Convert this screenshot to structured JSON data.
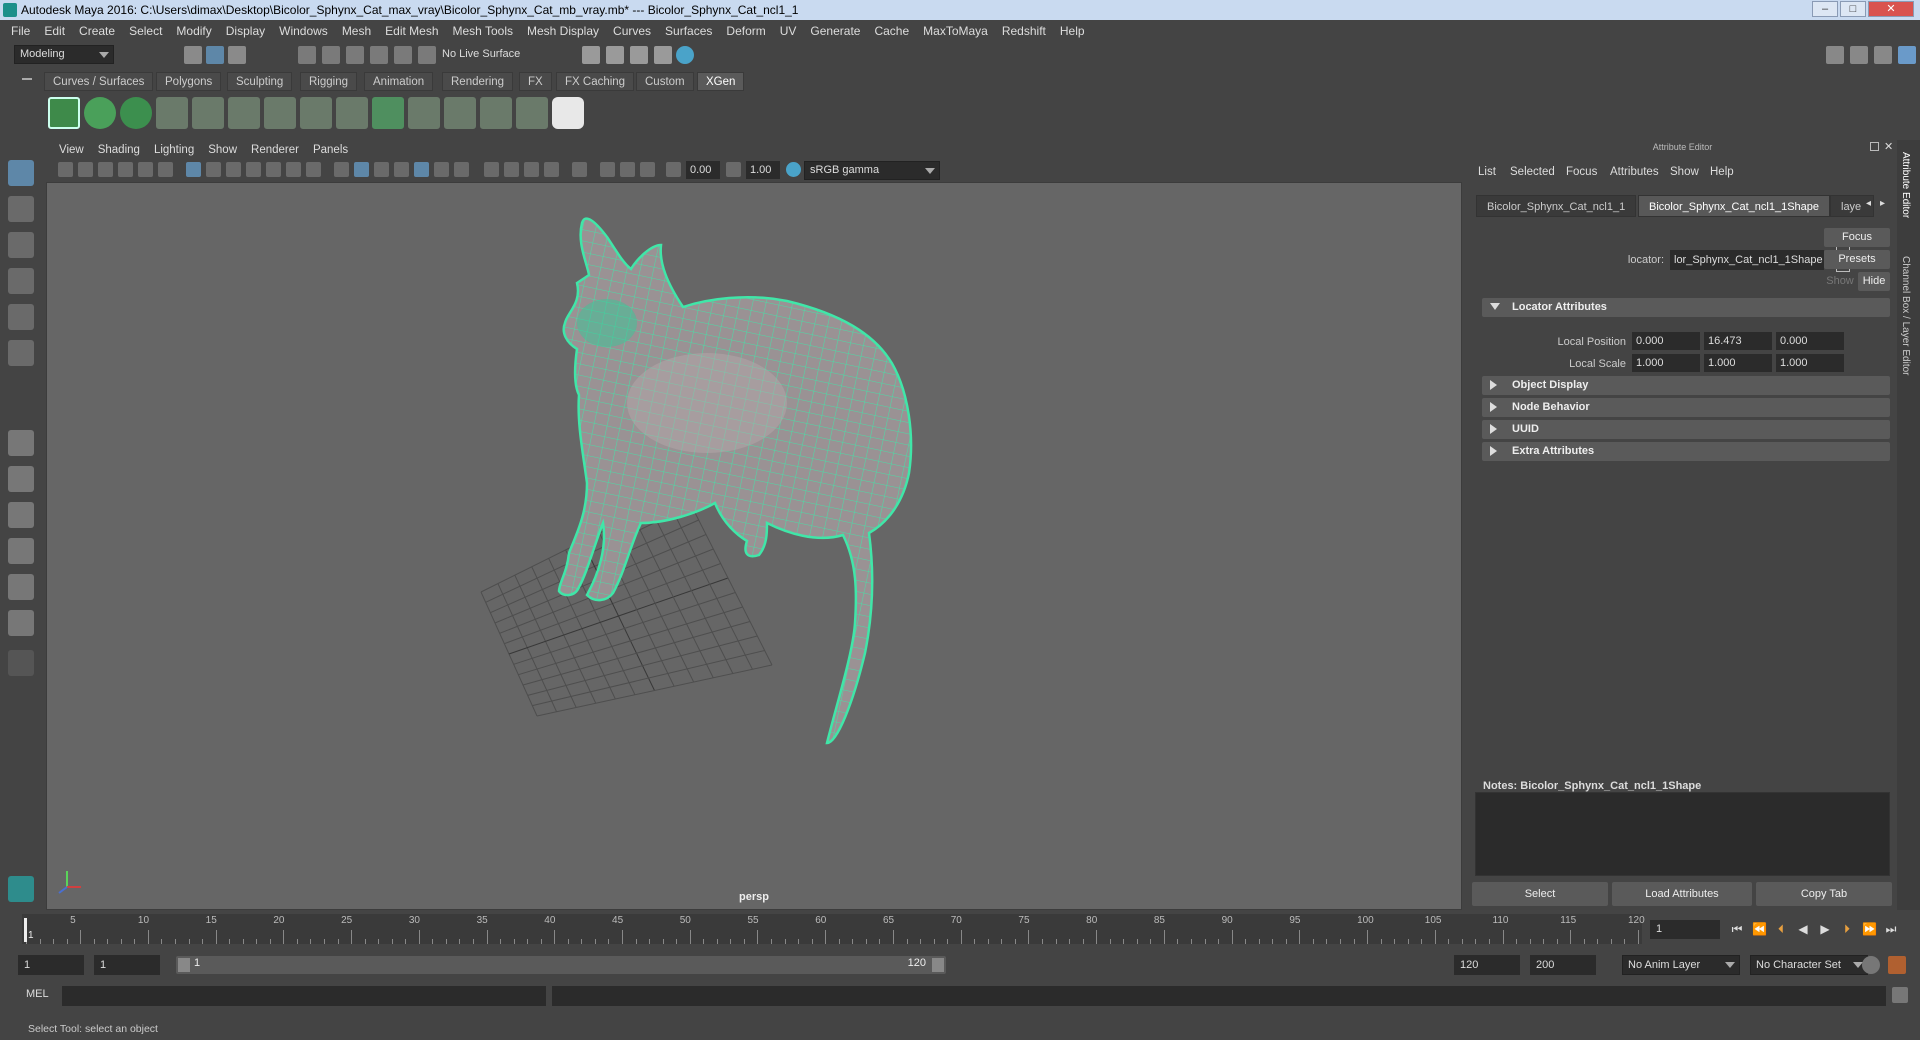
{
  "title_bar": {
    "text": "Autodesk Maya 2016: C:\\Users\\dimax\\Desktop\\Bicolor_Sphynx_Cat_max_vray\\Bicolor_Sphynx_Cat_mb_vray.mb*   ---   Bicolor_Sphynx_Cat_ncl1_1",
    "minimize": "–",
    "maximize": "□",
    "close": "✕"
  },
  "menu": [
    "File",
    "Edit",
    "Create",
    "Select",
    "Modify",
    "Display",
    "Windows",
    "Mesh",
    "Edit Mesh",
    "Mesh Tools",
    "Mesh Display",
    "Curves",
    "Surfaces",
    "Deform",
    "UV",
    "Generate",
    "Cache",
    "MaxToMaya",
    "Redshift",
    "Help"
  ],
  "status_line": {
    "mode": "Modeling",
    "live_surface": "No Live Surface"
  },
  "shelf_tabs": [
    "Curves / Surfaces",
    "Polygons",
    "Sculpting",
    "Rigging",
    "Animation",
    "Rendering",
    "FX",
    "FX Caching",
    "Custom",
    "XGen"
  ],
  "active_shelf_tab": "XGen",
  "panel_menu": [
    "View",
    "Shading",
    "Lighting",
    "Show",
    "Renderer",
    "Panels"
  ],
  "panel_tools": {
    "exposure": "0.00",
    "gamma": "1.00",
    "color_space": "sRGB gamma"
  },
  "viewport": {
    "camera": "persp",
    "wire_color": "#40e6a8",
    "background": "#666666"
  },
  "attribute_editor": {
    "header": "Attribute Editor",
    "menu": [
      "List",
      "Selected",
      "Focus",
      "Attributes",
      "Show",
      "Help"
    ],
    "tabs": [
      "Bicolor_Sphynx_Cat_ncl1_1",
      "Bicolor_Sphynx_Cat_ncl1_1Shape",
      "laye"
    ],
    "active_tab": "Bicolor_Sphynx_Cat_ncl1_1Shape",
    "node_type_label": "locator:",
    "node_name": "lor_Sphynx_Cat_ncl1_1Shape",
    "focus_button": "Focus",
    "presets_button": "Presets",
    "show_button": "Show",
    "hide_button": "Hide",
    "sections": [
      {
        "label": "Locator Attributes",
        "open": true
      },
      {
        "label": "Object Display",
        "open": false
      },
      {
        "label": "Node Behavior",
        "open": false
      },
      {
        "label": "UUID",
        "open": false
      },
      {
        "label": "Extra Attributes",
        "open": false
      }
    ],
    "local_position": {
      "label": "Local Position",
      "values": [
        "0.000",
        "16.473",
        "0.000"
      ]
    },
    "local_scale": {
      "label": "Local Scale",
      "values": [
        "1.000",
        "1.000",
        "1.000"
      ]
    },
    "notes_label": "Notes:  Bicolor_Sphynx_Cat_ncl1_1Shape",
    "bottom_buttons": [
      "Select",
      "Load Attributes",
      "Copy Tab"
    ]
  },
  "side_tabs": [
    "Attribute Editor",
    "Channel Box / Layer Editor"
  ],
  "time_slider": {
    "start": 1,
    "end": 120,
    "current": "1",
    "tick_labels": [
      "5",
      "10",
      "15",
      "20",
      "25",
      "30",
      "35",
      "40",
      "45",
      "50",
      "55",
      "60",
      "65",
      "70",
      "75",
      "80",
      "85",
      "90",
      "95",
      "100",
      "105",
      "110",
      "115",
      "120"
    ]
  },
  "current_frame_field": "1",
  "range": {
    "start_field": "1",
    "playback_start": "1",
    "range_start": "1",
    "range_end": "120",
    "playback_end": "120",
    "end_field": "200",
    "anim_layer": "No Anim Layer",
    "character_set": "No Character Set"
  },
  "command_line": {
    "label": "MEL"
  },
  "help_line": "Select Tool: select an object"
}
